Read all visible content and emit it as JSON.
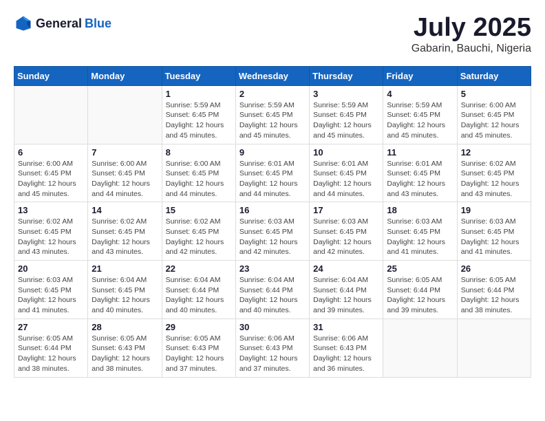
{
  "header": {
    "logo_general": "General",
    "logo_blue": "Blue",
    "month_year": "July 2025",
    "location": "Gabarin, Bauchi, Nigeria"
  },
  "weekdays": [
    "Sunday",
    "Monday",
    "Tuesday",
    "Wednesday",
    "Thursday",
    "Friday",
    "Saturday"
  ],
  "weeks": [
    [
      {
        "day": "",
        "sunrise": "",
        "sunset": "",
        "daylight": ""
      },
      {
        "day": "",
        "sunrise": "",
        "sunset": "",
        "daylight": ""
      },
      {
        "day": "1",
        "sunrise": "Sunrise: 5:59 AM",
        "sunset": "Sunset: 6:45 PM",
        "daylight": "Daylight: 12 hours and 45 minutes."
      },
      {
        "day": "2",
        "sunrise": "Sunrise: 5:59 AM",
        "sunset": "Sunset: 6:45 PM",
        "daylight": "Daylight: 12 hours and 45 minutes."
      },
      {
        "day": "3",
        "sunrise": "Sunrise: 5:59 AM",
        "sunset": "Sunset: 6:45 PM",
        "daylight": "Daylight: 12 hours and 45 minutes."
      },
      {
        "day": "4",
        "sunrise": "Sunrise: 5:59 AM",
        "sunset": "Sunset: 6:45 PM",
        "daylight": "Daylight: 12 hours and 45 minutes."
      },
      {
        "day": "5",
        "sunrise": "Sunrise: 6:00 AM",
        "sunset": "Sunset: 6:45 PM",
        "daylight": "Daylight: 12 hours and 45 minutes."
      }
    ],
    [
      {
        "day": "6",
        "sunrise": "Sunrise: 6:00 AM",
        "sunset": "Sunset: 6:45 PM",
        "daylight": "Daylight: 12 hours and 45 minutes."
      },
      {
        "day": "7",
        "sunrise": "Sunrise: 6:00 AM",
        "sunset": "Sunset: 6:45 PM",
        "daylight": "Daylight: 12 hours and 44 minutes."
      },
      {
        "day": "8",
        "sunrise": "Sunrise: 6:00 AM",
        "sunset": "Sunset: 6:45 PM",
        "daylight": "Daylight: 12 hours and 44 minutes."
      },
      {
        "day": "9",
        "sunrise": "Sunrise: 6:01 AM",
        "sunset": "Sunset: 6:45 PM",
        "daylight": "Daylight: 12 hours and 44 minutes."
      },
      {
        "day": "10",
        "sunrise": "Sunrise: 6:01 AM",
        "sunset": "Sunset: 6:45 PM",
        "daylight": "Daylight: 12 hours and 44 minutes."
      },
      {
        "day": "11",
        "sunrise": "Sunrise: 6:01 AM",
        "sunset": "Sunset: 6:45 PM",
        "daylight": "Daylight: 12 hours and 43 minutes."
      },
      {
        "day": "12",
        "sunrise": "Sunrise: 6:02 AM",
        "sunset": "Sunset: 6:45 PM",
        "daylight": "Daylight: 12 hours and 43 minutes."
      }
    ],
    [
      {
        "day": "13",
        "sunrise": "Sunrise: 6:02 AM",
        "sunset": "Sunset: 6:45 PM",
        "daylight": "Daylight: 12 hours and 43 minutes."
      },
      {
        "day": "14",
        "sunrise": "Sunrise: 6:02 AM",
        "sunset": "Sunset: 6:45 PM",
        "daylight": "Daylight: 12 hours and 43 minutes."
      },
      {
        "day": "15",
        "sunrise": "Sunrise: 6:02 AM",
        "sunset": "Sunset: 6:45 PM",
        "daylight": "Daylight: 12 hours and 42 minutes."
      },
      {
        "day": "16",
        "sunrise": "Sunrise: 6:03 AM",
        "sunset": "Sunset: 6:45 PM",
        "daylight": "Daylight: 12 hours and 42 minutes."
      },
      {
        "day": "17",
        "sunrise": "Sunrise: 6:03 AM",
        "sunset": "Sunset: 6:45 PM",
        "daylight": "Daylight: 12 hours and 42 minutes."
      },
      {
        "day": "18",
        "sunrise": "Sunrise: 6:03 AM",
        "sunset": "Sunset: 6:45 PM",
        "daylight": "Daylight: 12 hours and 41 minutes."
      },
      {
        "day": "19",
        "sunrise": "Sunrise: 6:03 AM",
        "sunset": "Sunset: 6:45 PM",
        "daylight": "Daylight: 12 hours and 41 minutes."
      }
    ],
    [
      {
        "day": "20",
        "sunrise": "Sunrise: 6:03 AM",
        "sunset": "Sunset: 6:45 PM",
        "daylight": "Daylight: 12 hours and 41 minutes."
      },
      {
        "day": "21",
        "sunrise": "Sunrise: 6:04 AM",
        "sunset": "Sunset: 6:45 PM",
        "daylight": "Daylight: 12 hours and 40 minutes."
      },
      {
        "day": "22",
        "sunrise": "Sunrise: 6:04 AM",
        "sunset": "Sunset: 6:44 PM",
        "daylight": "Daylight: 12 hours and 40 minutes."
      },
      {
        "day": "23",
        "sunrise": "Sunrise: 6:04 AM",
        "sunset": "Sunset: 6:44 PM",
        "daylight": "Daylight: 12 hours and 40 minutes."
      },
      {
        "day": "24",
        "sunrise": "Sunrise: 6:04 AM",
        "sunset": "Sunset: 6:44 PM",
        "daylight": "Daylight: 12 hours and 39 minutes."
      },
      {
        "day": "25",
        "sunrise": "Sunrise: 6:05 AM",
        "sunset": "Sunset: 6:44 PM",
        "daylight": "Daylight: 12 hours and 39 minutes."
      },
      {
        "day": "26",
        "sunrise": "Sunrise: 6:05 AM",
        "sunset": "Sunset: 6:44 PM",
        "daylight": "Daylight: 12 hours and 38 minutes."
      }
    ],
    [
      {
        "day": "27",
        "sunrise": "Sunrise: 6:05 AM",
        "sunset": "Sunset: 6:44 PM",
        "daylight": "Daylight: 12 hours and 38 minutes."
      },
      {
        "day": "28",
        "sunrise": "Sunrise: 6:05 AM",
        "sunset": "Sunset: 6:43 PM",
        "daylight": "Daylight: 12 hours and 38 minutes."
      },
      {
        "day": "29",
        "sunrise": "Sunrise: 6:05 AM",
        "sunset": "Sunset: 6:43 PM",
        "daylight": "Daylight: 12 hours and 37 minutes."
      },
      {
        "day": "30",
        "sunrise": "Sunrise: 6:06 AM",
        "sunset": "Sunset: 6:43 PM",
        "daylight": "Daylight: 12 hours and 37 minutes."
      },
      {
        "day": "31",
        "sunrise": "Sunrise: 6:06 AM",
        "sunset": "Sunset: 6:43 PM",
        "daylight": "Daylight: 12 hours and 36 minutes."
      },
      {
        "day": "",
        "sunrise": "",
        "sunset": "",
        "daylight": ""
      },
      {
        "day": "",
        "sunrise": "",
        "sunset": "",
        "daylight": ""
      }
    ]
  ]
}
